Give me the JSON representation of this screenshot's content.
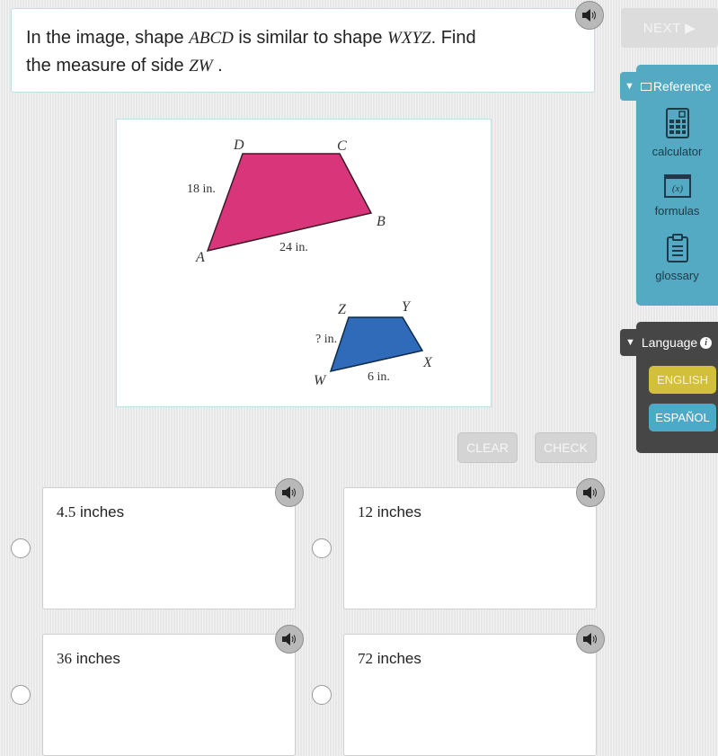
{
  "question": {
    "prefix": "In the image, shape ",
    "shape1": "ABCD",
    "middle": " is similar to shape ",
    "shape2": "WXYZ",
    "after": ". Find",
    "line2_prefix": "the measure of side ",
    "side": "ZW",
    "line2_suffix": " ."
  },
  "header": {
    "next_label": "NEXT ▶"
  },
  "reference": {
    "title": "Reference",
    "items": [
      {
        "icon": "calculator-icon",
        "label": "calculator"
      },
      {
        "icon": "formulas-icon",
        "label": "formulas",
        "glyph": "(x)"
      },
      {
        "icon": "glossary-icon",
        "label": "glossary"
      }
    ]
  },
  "language": {
    "title": "Language",
    "info_glyph": "i",
    "options": [
      "ENGLISH",
      "ESPAÑOL"
    ],
    "selected": "ENGLISH"
  },
  "figure": {
    "large_shape": {
      "color": "#d8357a",
      "vertices": [
        "A",
        "B",
        "C",
        "D"
      ],
      "side_labels": {
        "AD": "18 in.",
        "AB": "24 in."
      }
    },
    "small_shape": {
      "color": "#2f6bb8",
      "vertices": [
        "W",
        "X",
        "Y",
        "Z"
      ],
      "side_labels": {
        "WZ": "? in.",
        "WX": "6 in."
      }
    }
  },
  "actions": {
    "clear_label": "CLEAR",
    "check_label": "CHECK"
  },
  "answers": [
    {
      "value": "4.5",
      "unit": " inches"
    },
    {
      "value": "12",
      "unit": " inches"
    },
    {
      "value": "36",
      "unit": " inches"
    },
    {
      "value": "72",
      "unit": " inches"
    }
  ]
}
